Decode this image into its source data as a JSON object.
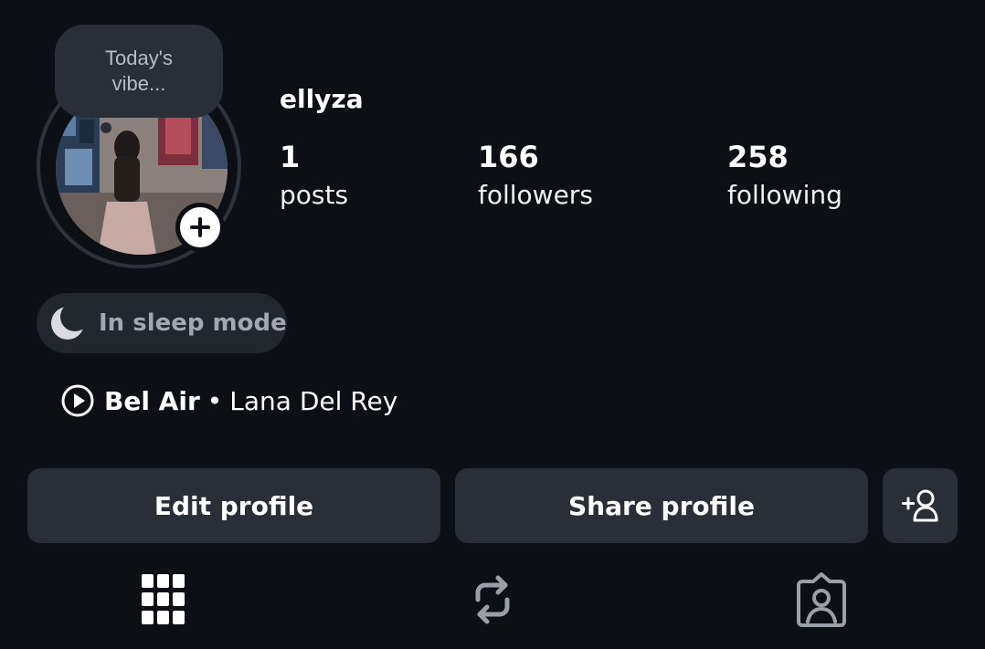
{
  "profile": {
    "username": "ellyza",
    "note": "Today's vibe...",
    "stats": [
      {
        "value": "1",
        "label": "posts"
      },
      {
        "value": "166",
        "label": "followers"
      },
      {
        "value": "258",
        "label": "following"
      }
    ],
    "status": "In sleep mode",
    "music": {
      "song": "Bel Air",
      "separator": "•",
      "artist": "Lana Del Rey"
    }
  },
  "actions": {
    "edit_label": "Edit profile",
    "share_label": "Share profile",
    "add_icon": "person-add-icon"
  },
  "tabs": [
    {
      "icon": "grid-icon",
      "selected": true
    },
    {
      "icon": "repost-icon",
      "selected": false
    },
    {
      "icon": "tagged-icon",
      "selected": false
    }
  ],
  "colors": {
    "background": "#0c0f14",
    "button": "#2a2f37",
    "muted_text": "#a3a8b0",
    "inactive_tab": "#9aa0a8"
  }
}
